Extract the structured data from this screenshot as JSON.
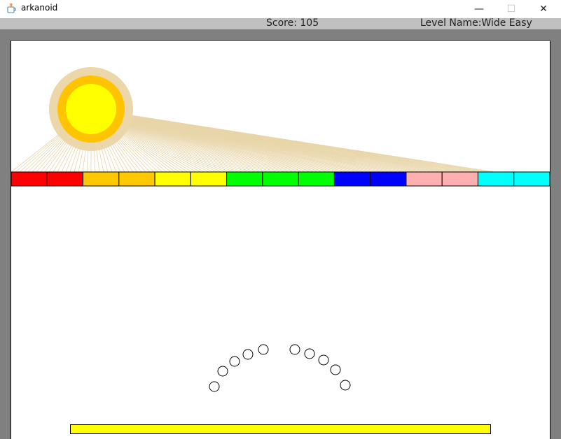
{
  "window": {
    "title": "arkanoid",
    "min_glyph": "—",
    "max_glyph": "☐",
    "close_glyph": "✕"
  },
  "hud": {
    "score_text": "Score: 105",
    "level_text": "Level Name:Wide Easy"
  },
  "colors": {
    "frame": "#808080",
    "background": "#ffffff",
    "paddle": "#ffff00",
    "ray": "#e8d5a8",
    "sun_halo": "#ecd7aa",
    "sun_ring": "#ffc300",
    "sun_core": "#ffff00"
  },
  "blocks": [
    {
      "color": "#ff0000"
    },
    {
      "color": "#ff0000"
    },
    {
      "color": "#ffc800"
    },
    {
      "color": "#ffc800"
    },
    {
      "color": "#ffff00"
    },
    {
      "color": "#ffff00"
    },
    {
      "color": "#00ff00"
    },
    {
      "color": "#00ff00"
    },
    {
      "color": "#00ff00"
    },
    {
      "color": "#0000ff"
    },
    {
      "color": "#0000ff"
    },
    {
      "color": "#ffafaf"
    },
    {
      "color": "#ffafaf"
    },
    {
      "color": "#00ffff"
    },
    {
      "color": "#00ffff"
    }
  ],
  "balls_count": 10
}
